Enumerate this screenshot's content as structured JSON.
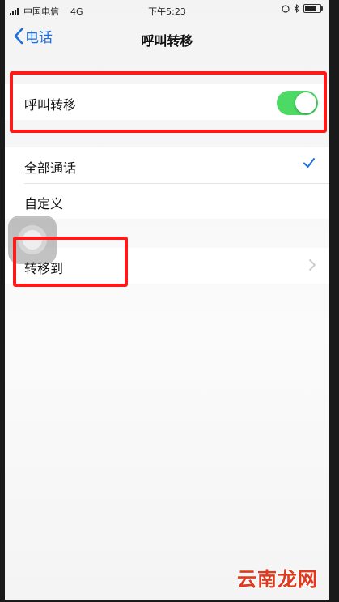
{
  "status_bar": {
    "carrier": "中国电信",
    "network": "4G",
    "time": "下午5:23",
    "battery_level": 0.85
  },
  "nav": {
    "back_label": "电话",
    "title": "呼叫转移"
  },
  "forward_toggle": {
    "label": "呼叫转移",
    "on": true
  },
  "options": [
    {
      "label": "全部通话",
      "selected": true
    },
    {
      "label": "自定义",
      "selected": false
    }
  ],
  "forward_to": {
    "label": "转移到"
  },
  "watermark": "云南龙网",
  "colors": {
    "accent": "#1e6fe0",
    "toggle_on": "#4cd964",
    "highlight_box": "#ff1a1a",
    "watermark": "#e03a1e"
  }
}
